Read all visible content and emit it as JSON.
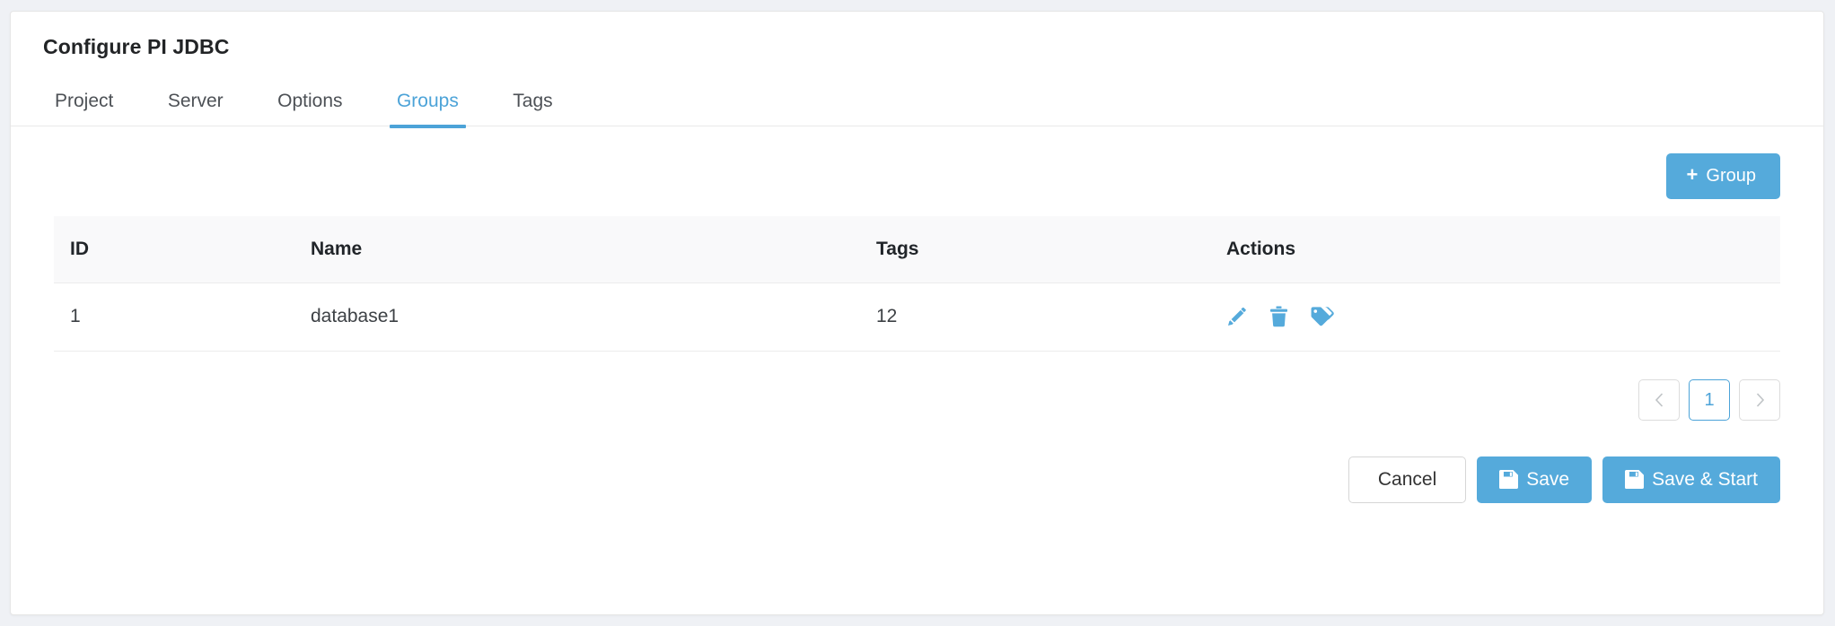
{
  "window": {
    "title": "Configure PI JDBC",
    "background_color": "#eff1f5",
    "card_background": "#ffffff",
    "accent_color": "#55aadb"
  },
  "tabs": [
    {
      "label": "Project",
      "active": false
    },
    {
      "label": "Server",
      "active": false
    },
    {
      "label": "Options",
      "active": false
    },
    {
      "label": "Groups",
      "active": true
    },
    {
      "label": "Tags",
      "active": false
    }
  ],
  "toolbar": {
    "add_group_label": "Group",
    "add_group_plus": "+",
    "add_group_icon": "plus-icon"
  },
  "table": {
    "columns": [
      "ID",
      "Name",
      "Tags",
      "Actions"
    ],
    "rows": [
      {
        "id": "1",
        "name": "database1",
        "tags": "12",
        "actions": [
          "edit-pencil-icon",
          "delete-trash-icon",
          "tags-icon"
        ]
      }
    ]
  },
  "pagination": {
    "prev_label": "‹",
    "prev_icon": "chevron-left-icon",
    "next_label": "›",
    "next_icon": "chevron-right-icon",
    "pages": [
      "1"
    ],
    "current_page": "1"
  },
  "footer": {
    "cancel_label": "Cancel",
    "save_label": "Save",
    "save_start_label": "Save & Start",
    "save_icon": "floppy-disk-icon"
  }
}
